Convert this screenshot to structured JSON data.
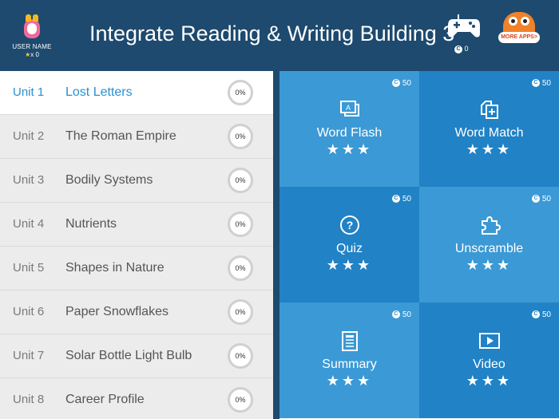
{
  "header": {
    "title": "Integrate Reading & Writing Building 3",
    "user_name": "USER NAME",
    "user_stars": "x 0",
    "coins": "0",
    "more_apps": "MORE APPS>"
  },
  "units": [
    {
      "num": "Unit 1",
      "title": "Lost Letters",
      "progress": "0%"
    },
    {
      "num": "Unit 2",
      "title": "The Roman Empire",
      "progress": "0%"
    },
    {
      "num": "Unit 3",
      "title": "Bodily Systems",
      "progress": "0%"
    },
    {
      "num": "Unit 4",
      "title": "Nutrients",
      "progress": "0%"
    },
    {
      "num": "Unit 5",
      "title": "Shapes in Nature",
      "progress": "0%"
    },
    {
      "num": "Unit 6",
      "title": "Paper Snowflakes",
      "progress": "0%"
    },
    {
      "num": "Unit 7",
      "title": "Solar Bottle Light Bulb",
      "progress": "0%"
    },
    {
      "num": "Unit 8",
      "title": "Career Profile",
      "progress": "0%"
    }
  ],
  "activities": [
    {
      "label": "Word Flash",
      "cost": "50",
      "stars": "★★★",
      "icon": "word-flash-icon"
    },
    {
      "label": "Word Match",
      "cost": "50",
      "stars": "★★★",
      "icon": "word-match-icon"
    },
    {
      "label": "Quiz",
      "cost": "50",
      "stars": "★★★",
      "icon": "quiz-icon"
    },
    {
      "label": "Unscramble",
      "cost": "50",
      "stars": "★★★",
      "icon": "puzzle-icon"
    },
    {
      "label": "Summary",
      "cost": "50",
      "stars": "★★★",
      "icon": "summary-icon"
    },
    {
      "label": "Video",
      "cost": "50",
      "stars": "★★★",
      "icon": "video-icon"
    }
  ],
  "colors": {
    "header_bg": "#1d4a6e",
    "tile_light": "#3b99d5",
    "tile_dark": "#2182c6",
    "active_unit": "#2b8fd0"
  }
}
